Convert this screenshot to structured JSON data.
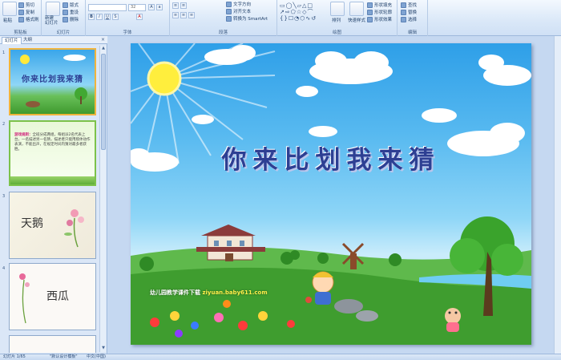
{
  "ribbon": {
    "clipboard": {
      "paste": "粘贴",
      "cut": "剪切",
      "copy": "复制",
      "format_painter": "格式刷",
      "group": "剪贴板"
    },
    "slides": {
      "new_slide": "新建\n幻灯片",
      "layout": "版式",
      "reset": "重设",
      "delete": "删除",
      "group": "幻灯片"
    },
    "font": {
      "font_size": "32",
      "group": "字体"
    },
    "paragraph": {
      "text_direction": "文字方向",
      "align_text": "对齐文本",
      "smartart": "转换为 SmartArt",
      "group": "段落"
    },
    "drawing": {
      "arrange": "排列",
      "quick_styles": "快速样式",
      "shape_fill": "形状填充",
      "shape_outline": "形状轮廓",
      "shape_effects": "形状效果",
      "group": "绘图"
    },
    "editing": {
      "find": "查找",
      "replace": "替换",
      "select": "选择",
      "group": "编辑"
    }
  },
  "panel": {
    "tab_slides": "幻灯片",
    "tab_outline": "大纲",
    "close": "×",
    "thumbnails": [
      {
        "num": "1",
        "title": "你来比划我来猜"
      },
      {
        "num": "2",
        "lead": "游戏规则：",
        "body": "全班分成两组，每组派2名代表上台，一名描述另一名猜，描述者只能用肢体动作表演，不能出声，在规定时间内猜对最多者获胜。"
      },
      {
        "num": "3",
        "word": "天鹅"
      },
      {
        "num": "4",
        "word": "西瓜"
      }
    ]
  },
  "slide": {
    "title": "你来比划我来猜",
    "caption_prefix": "幼儿园教学课件下载",
    "caption_url": "ziyuan.baby611.com"
  },
  "status": {
    "slide_pos": "幻灯片 1/65",
    "theme": "\"默认设计模板\"",
    "language": "中文(中国)"
  },
  "colors": {
    "title": "#2d3f93",
    "selection": "#f0b43c",
    "ribbon": "#dae8f8"
  }
}
